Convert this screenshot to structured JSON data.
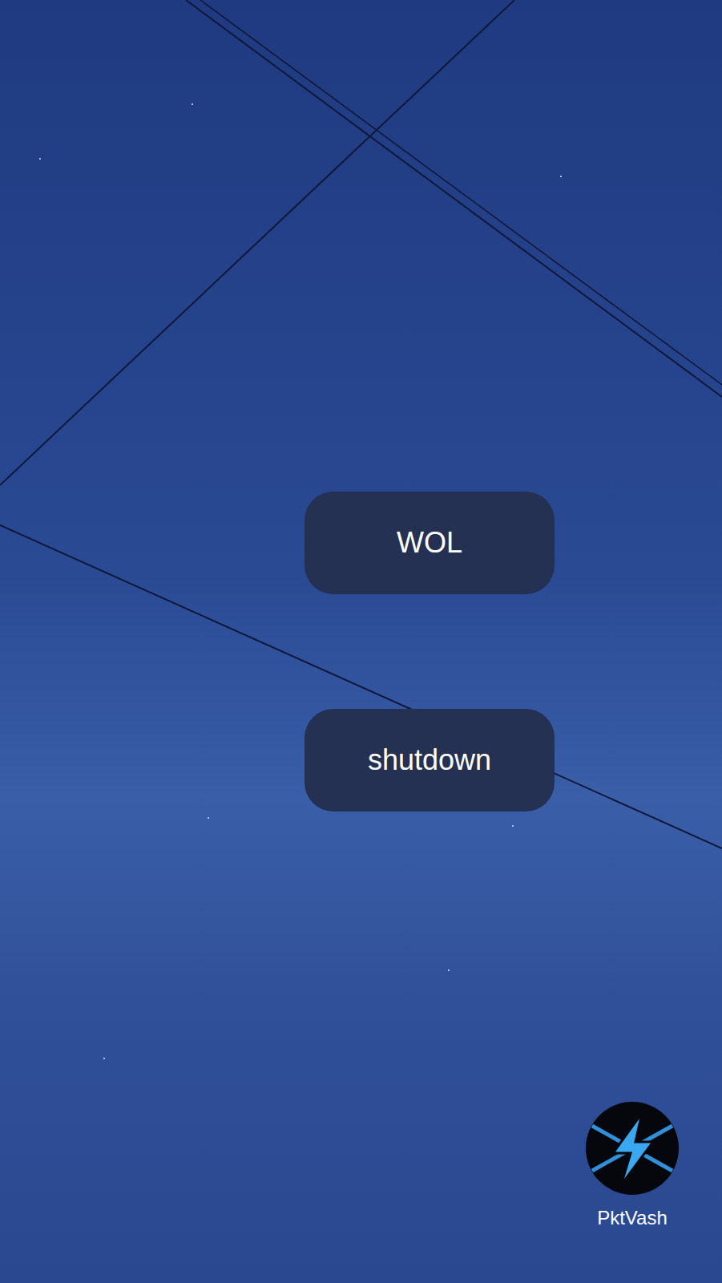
{
  "widgets": [
    {
      "label": "WOL"
    },
    {
      "label": "shutdown"
    }
  ],
  "apps": [
    {
      "label": "PktVash"
    }
  ]
}
